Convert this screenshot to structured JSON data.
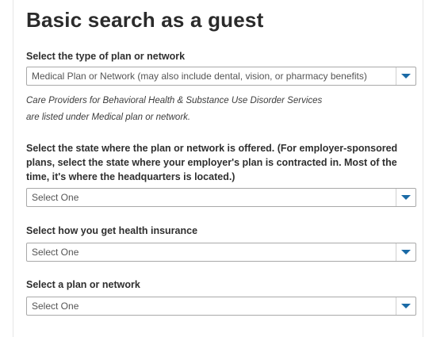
{
  "page": {
    "title": "Basic search as a guest"
  },
  "plan_type": {
    "label": "Select the type of plan or network",
    "value": "Medical Plan or Network (may also include dental, vision, or pharmacy benefits)",
    "icon": "chevron-down-icon"
  },
  "note": {
    "line1": "Care Providers for Behavioral Health & Substance Use Disorder Services",
    "line2": "are listed under Medical plan or network."
  },
  "state": {
    "label": "Select the state where the plan or network is offered. (For employer-sponsored plans, select the state where your employer's plan is contracted in. Most of the time, it's where the headquarters is located.)",
    "value": "Select One",
    "icon": "chevron-down-icon"
  },
  "insurance_source": {
    "label": "Select how you get health insurance",
    "value": "Select One",
    "icon": "chevron-down-icon"
  },
  "plan": {
    "label": "Select a plan or network",
    "value": "Select One",
    "icon": "chevron-down-icon"
  },
  "colors": {
    "accent": "#1a6aa6",
    "border": "#a9a9a9",
    "text": "#333333"
  }
}
